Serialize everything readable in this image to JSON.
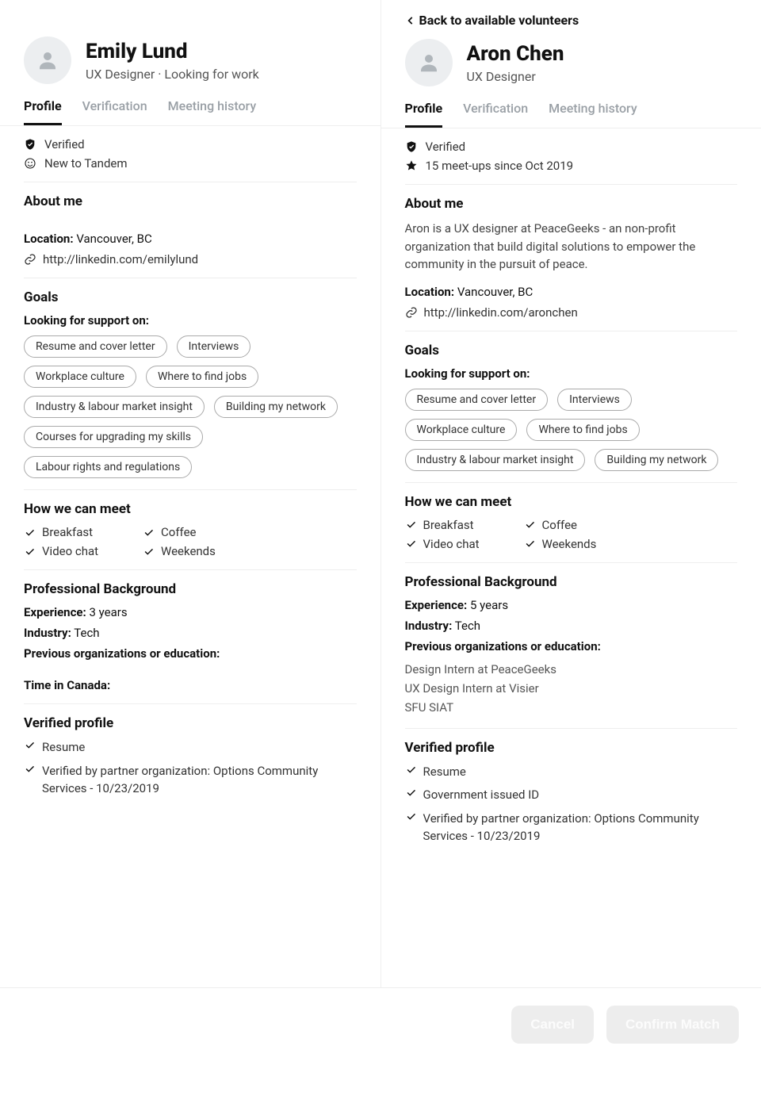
{
  "left": {
    "name": "Emily Lund",
    "subtitle": "UX Designer · Looking for work",
    "tabs": [
      "Profile",
      "Verification",
      "Meeting history"
    ],
    "status": {
      "verified": "Verified",
      "detail": "New to Tandem"
    },
    "about": {
      "heading": "About me",
      "text": "",
      "location_label": "Location:",
      "location_value": "Vancouver, BC",
      "link": "http://linkedin.com/emilylund"
    },
    "goals": {
      "heading": "Goals",
      "subheading": "Looking for support on:",
      "chips": [
        "Resume and cover letter",
        "Interviews",
        "Workplace culture",
        "Where to find jobs",
        "Industry & labour market insight",
        "Building my network",
        "Courses for upgrading my skills",
        "Labour rights and regulations"
      ]
    },
    "meet": {
      "heading": "How we can meet",
      "items": [
        "Breakfast",
        "Coffee",
        "Video chat",
        "Weekends"
      ]
    },
    "background": {
      "heading": "Professional Background",
      "experience_label": "Experience:",
      "experience_value": "3 years",
      "industry_label": "Industry:",
      "industry_value": "Tech",
      "prev_label": "Previous organizations or education:",
      "prev_items": [],
      "time_label": "Time in Canada:",
      "time_value": ""
    },
    "verified": {
      "heading": "Verified profile",
      "items": [
        "Resume",
        "Verified by partner organization: Options Community Services - 10/23/2019"
      ]
    }
  },
  "right": {
    "back_label": "Back to available volunteers",
    "name": "Aron Chen",
    "subtitle": "UX Designer",
    "tabs": [
      "Profile",
      "Verification",
      "Meeting history"
    ],
    "status": {
      "verified": "Verified",
      "detail": "15 meet-ups since Oct 2019"
    },
    "about": {
      "heading": "About me",
      "text": "Aron is a UX designer at PeaceGeeks - an non-profit organization that build digital solutions to empower the community in the pursuit of peace.",
      "location_label": "Location:",
      "location_value": "Vancouver, BC",
      "link": "http://linkedin.com/aronchen"
    },
    "goals": {
      "heading": "Goals",
      "subheading": "Looking for support on:",
      "chips": [
        "Resume and cover letter",
        "Interviews",
        "Workplace culture",
        "Where to find jobs",
        "Industry & labour market insight",
        "Building my network"
      ]
    },
    "meet": {
      "heading": "How we can meet",
      "items": [
        "Breakfast",
        "Coffee",
        "Video chat",
        "Weekends"
      ]
    },
    "background": {
      "heading": "Professional Background",
      "experience_label": "Experience:",
      "experience_value": "5 years",
      "industry_label": "Industry:",
      "industry_value": "Tech",
      "prev_label": "Previous organizations or education:",
      "prev_items": [
        "Design Intern at PeaceGeeks",
        "UX Design Intern at Visier",
        "SFU SIAT"
      ]
    },
    "verified": {
      "heading": "Verified profile",
      "items": [
        "Resume",
        "Government issued ID",
        "Verified by partner organization: Options Community Services - 10/23/2019"
      ]
    }
  },
  "footer": {
    "cancel": "Cancel",
    "confirm": "Confirm Match"
  }
}
